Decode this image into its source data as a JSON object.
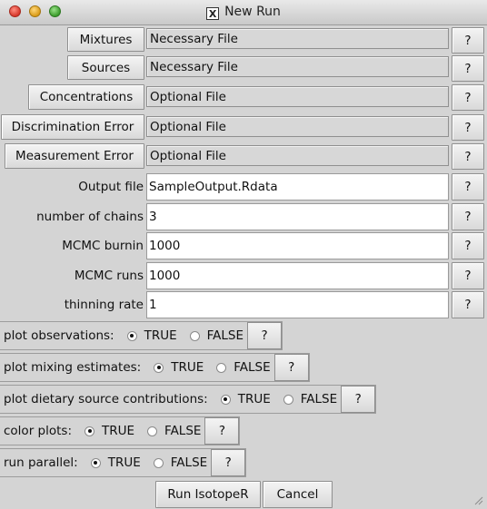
{
  "window": {
    "title": "New Run",
    "title_icon": "X"
  },
  "file_rows": [
    {
      "button": "Mixtures",
      "value": "Necessary File",
      "help": "?"
    },
    {
      "button": "Sources",
      "value": "Necessary File",
      "help": "?"
    },
    {
      "button": "Concentrations",
      "value": "Optional File",
      "help": "?"
    },
    {
      "button": "Discrimination Error",
      "value": "Optional File",
      "help": "?"
    },
    {
      "button": "Measurement Error",
      "value": "Optional File",
      "help": "?"
    }
  ],
  "param_rows": [
    {
      "label": "Output file",
      "value": "SampleOutput.Rdata",
      "help": "?"
    },
    {
      "label": "number of chains",
      "value": "3",
      "help": "?"
    },
    {
      "label": "MCMC burnin",
      "value": "1000",
      "help": "?"
    },
    {
      "label": "MCMC runs",
      "value": "1000",
      "help": "?"
    },
    {
      "label": "thinning rate",
      "value": "1",
      "help": "?"
    }
  ],
  "option_rows": [
    {
      "label": "plot observations:",
      "true_label": "TRUE",
      "false_label": "FALSE",
      "selected": "TRUE",
      "help": "?"
    },
    {
      "label": "plot mixing estimates:",
      "true_label": "TRUE",
      "false_label": "FALSE",
      "selected": "TRUE",
      "help": "?"
    },
    {
      "label": "plot dietary source contributions:",
      "true_label": "TRUE",
      "false_label": "FALSE",
      "selected": "TRUE",
      "help": "?"
    },
    {
      "label": "color plots:",
      "true_label": "TRUE",
      "false_label": "FALSE",
      "selected": "TRUE",
      "help": "?"
    },
    {
      "label": "run parallel:",
      "true_label": "TRUE",
      "false_label": "FALSE",
      "selected": "TRUE",
      "help": "?"
    }
  ],
  "actions": {
    "run": "Run IsotopeR",
    "cancel": "Cancel"
  }
}
